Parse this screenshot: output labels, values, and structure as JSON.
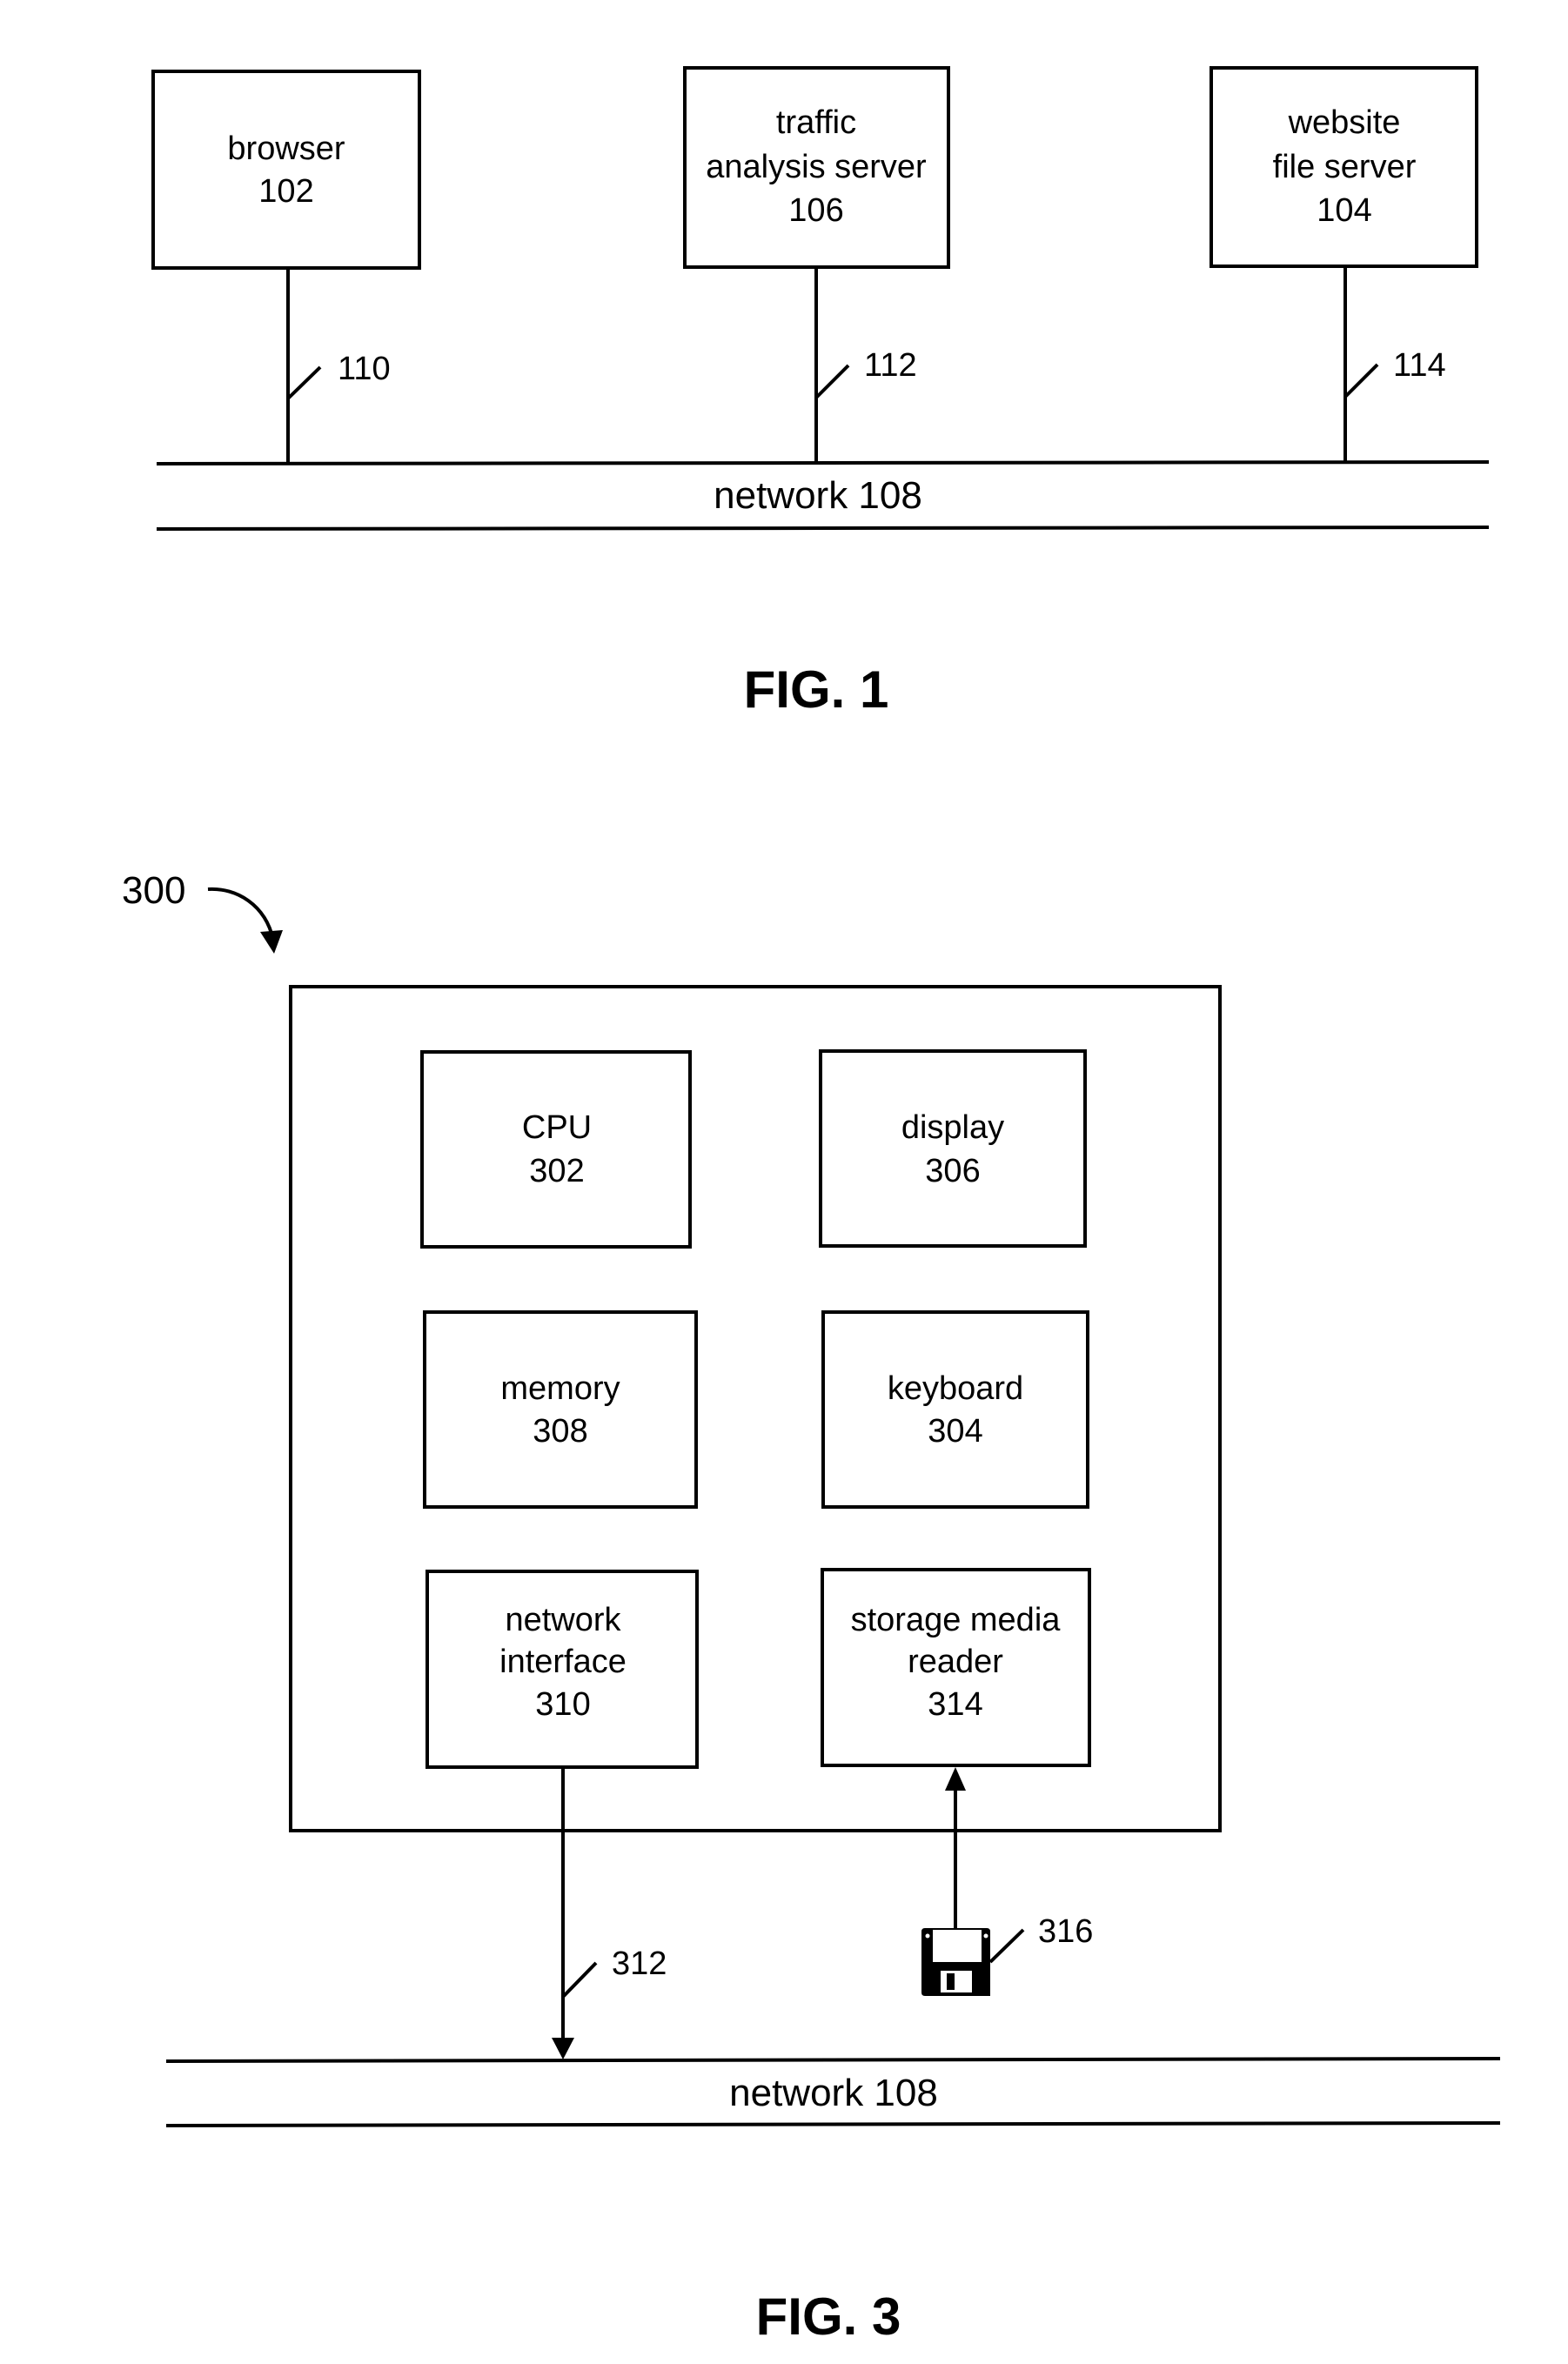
{
  "fig1": {
    "caption": "FIG. 1",
    "nodes": [
      {
        "id": "browser",
        "lines": [
          "browser",
          "102"
        ]
      },
      {
        "id": "traffic-analysis-server",
        "lines": [
          "traffic",
          "analysis server",
          "106"
        ]
      },
      {
        "id": "website-file-server",
        "lines": [
          "website",
          "file server",
          "104"
        ]
      }
    ],
    "links": [
      "110",
      "112",
      "114"
    ],
    "network_label": "network 108"
  },
  "fig3": {
    "caption": "FIG. 3",
    "system_ref": "300",
    "components": [
      {
        "id": "cpu",
        "lines": [
          "CPU",
          "302"
        ]
      },
      {
        "id": "display",
        "lines": [
          "display",
          "306"
        ]
      },
      {
        "id": "memory",
        "lines": [
          "memory",
          "308"
        ]
      },
      {
        "id": "keyboard",
        "lines": [
          "keyboard",
          "304"
        ]
      },
      {
        "id": "network-interface",
        "lines": [
          "network",
          "interface",
          "310"
        ]
      },
      {
        "id": "storage-media-reader",
        "lines": [
          "storage media",
          "reader",
          "314"
        ]
      }
    ],
    "network_link_ref": "312",
    "storage_media_ref": "316",
    "storage_media_icon": "floppy-disk-icon",
    "network_label": "network 108"
  }
}
